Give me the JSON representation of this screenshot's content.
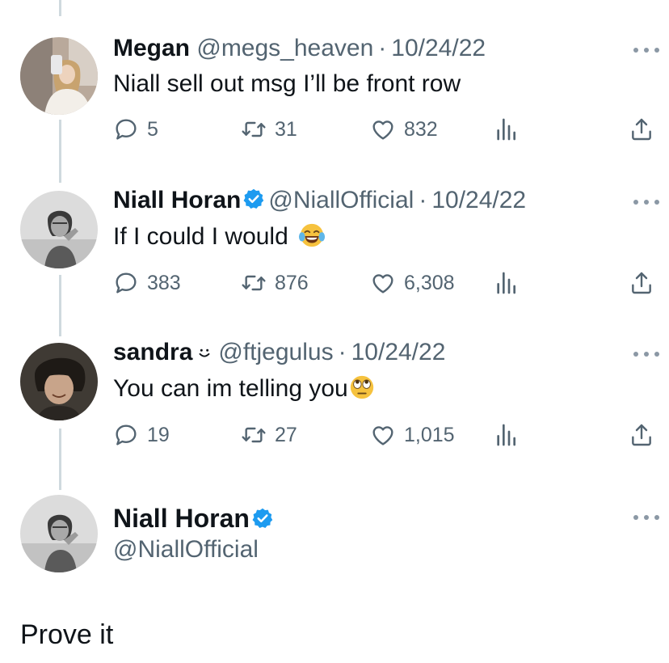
{
  "tweets": [
    {
      "name": "Megan",
      "handle": "@megs_heaven",
      "separator": "·",
      "date": "10/24/22",
      "text": "Niall sell out msg I’ll be front row",
      "verified": false,
      "stats": {
        "replies": "5",
        "retweets": "31",
        "likes": "832"
      }
    },
    {
      "name": "Niall Horan",
      "handle": "@NiallOfficial",
      "separator": "·",
      "date": "10/24/22",
      "text": "If I could I would",
      "emoji": "face-with-tears-of-joy",
      "verified": true,
      "stats": {
        "replies": "383",
        "retweets": "876",
        "likes": "6,308"
      }
    },
    {
      "name": "sandra",
      "name_emoji": "smiley",
      "handle": "@ftjegulus",
      "separator": "·",
      "date": "10/24/22",
      "text": "You can im telling you",
      "emoji": "face-with-rolling-eyes",
      "verified": false,
      "stats": {
        "replies": "19",
        "retweets": "27",
        "likes": "1,015"
      }
    }
  ],
  "main_tweet": {
    "name": "Niall Horan",
    "handle": "@NiallOfficial",
    "verified": true,
    "text": "Prove it"
  },
  "colors": {
    "text": "#0f1419",
    "secondary": "#536471",
    "verified": "#1d9bf0",
    "thread_line": "#cfd9de"
  },
  "icons": [
    "reply-icon",
    "retweet-icon",
    "like-icon",
    "views-icon",
    "share-icon",
    "more-icon",
    "verified-badge-icon"
  ]
}
